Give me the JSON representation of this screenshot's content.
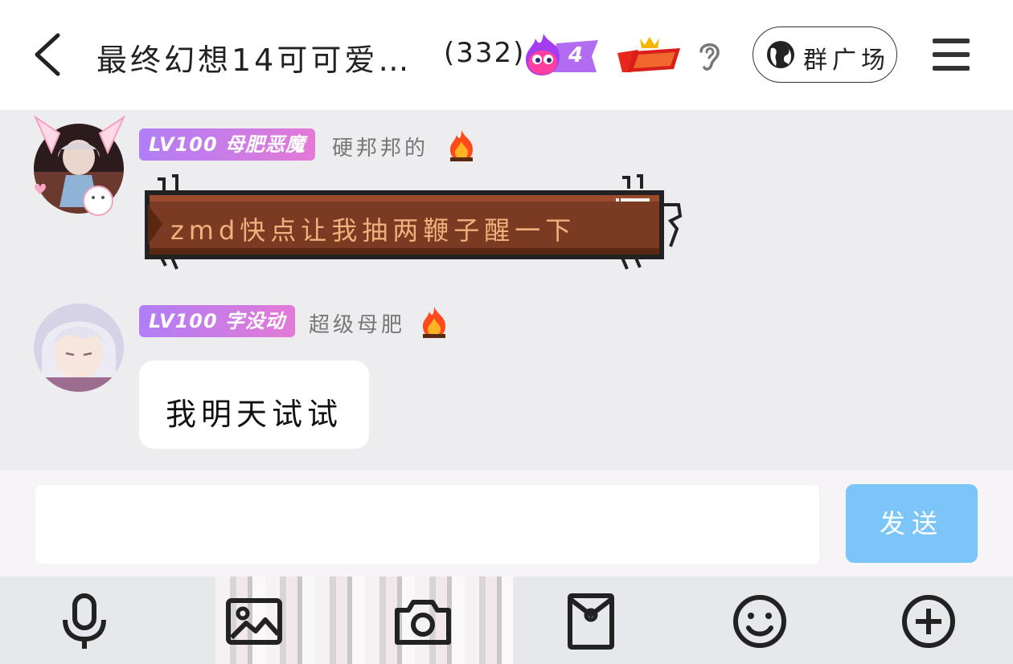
{
  "header": {
    "title": "最终幻想14可可爱…",
    "member_count": "(332)",
    "level_badge_number": "4",
    "plaza_label": "群广场",
    "icons": [
      "back-arrow-icon",
      "flame-badge-icon",
      "king-badge-icon",
      "ear-icon",
      "globe-icon",
      "menu-icon"
    ]
  },
  "messages": [
    {
      "badge": "LV100 母肥恶魔",
      "sender": "硬邦邦的",
      "text": "zmd快点让我抽两鞭子醒一下",
      "style": "wooden-plank-bubble"
    },
    {
      "badge": "LV100 字没动",
      "sender": "超级母肥",
      "text": "我明天试试",
      "style": "white-bubble"
    }
  ],
  "composer": {
    "input_value": "",
    "input_placeholder": "",
    "send_label": "发送"
  },
  "toolbar": {
    "items": [
      "microphone-icon",
      "image-icon",
      "camera-icon",
      "red-packet-icon",
      "emoji-icon",
      "plus-icon"
    ]
  },
  "colors": {
    "badge_gradient": [
      "#b07ef6",
      "#e37ad7"
    ],
    "send_button": "#7cc5f9",
    "plank_text": "#f1b07c"
  }
}
